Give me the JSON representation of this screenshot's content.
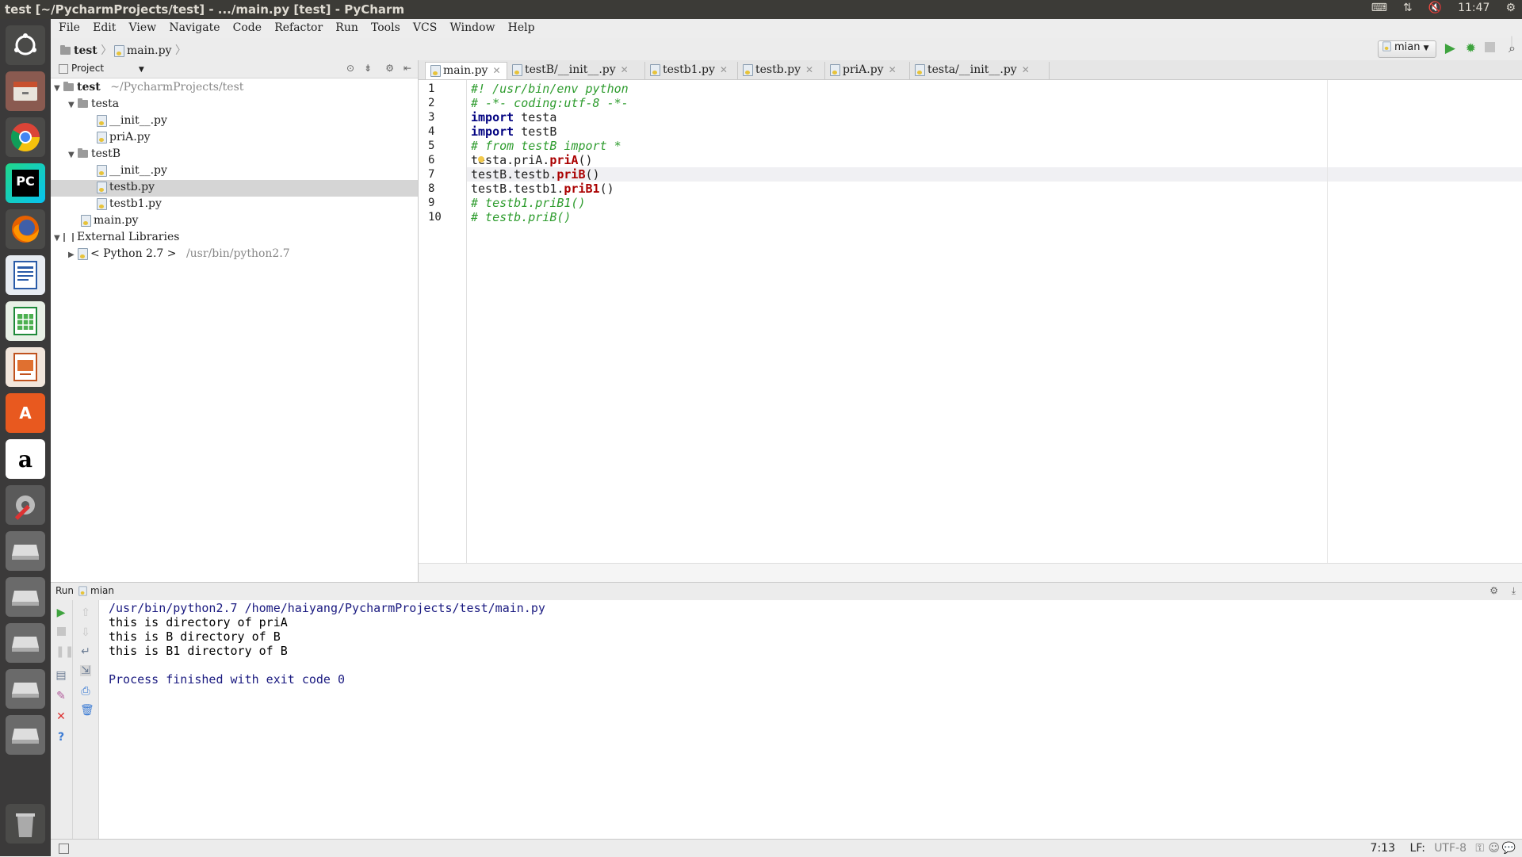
{
  "window": {
    "title": "test [~/PycharmProjects/test] - .../main.py [test] - PyCharm",
    "clock": "11:47"
  },
  "launcher": {
    "items": [
      "ubuntu-dash",
      "files",
      "chrome",
      "pycharm",
      "firefox",
      "writer",
      "calc",
      "impress",
      "software-center",
      "amazon",
      "system-settings",
      "drive-1",
      "drive-2",
      "drive-3",
      "drive-4",
      "drive-5",
      "trash"
    ],
    "pycharm_label": "PC",
    "amazon_label": "a",
    "software_label": "A"
  },
  "menu": [
    "File",
    "Edit",
    "View",
    "Navigate",
    "Code",
    "Refactor",
    "Run",
    "Tools",
    "VCS",
    "Window",
    "Help"
  ],
  "navbar": {
    "crumb_project": "test",
    "crumb_file": "main.py",
    "run_config": "mian"
  },
  "project": {
    "header": "Project",
    "tree": [
      {
        "label": "test",
        "extra": "~/PycharmProjects/test"
      },
      {
        "label": "testa"
      },
      {
        "label": "__init__.py"
      },
      {
        "label": "priA.py"
      },
      {
        "label": "testB"
      },
      {
        "label": "__init__.py"
      },
      {
        "label": "testb.py"
      },
      {
        "label": "testb1.py"
      },
      {
        "label": "main.py"
      },
      {
        "label": "External Libraries"
      },
      {
        "label": "< Python 2.7 >",
        "extra": "/usr/bin/python2.7"
      }
    ]
  },
  "tabs": [
    "main.py",
    "testB/__init__.py",
    "testb1.py",
    "testb.py",
    "priA.py",
    "testa/__init__.py"
  ],
  "editor": {
    "line_numbers": [
      "1",
      "2",
      "3",
      "4",
      "5",
      "6",
      "7",
      "8",
      "9",
      "10"
    ],
    "lines": {
      "l1": "#! /usr/bin/env python",
      "l2": "# -*- coding:utf-8 -*-",
      "l3_kw": "import",
      "l3_rest": " testa",
      "l4_kw": "import",
      "l4_rest": " testB",
      "l5": "# from testB import *",
      "l6_pre": "testa.priA.",
      "l6_fn": "priA",
      "l6_post": "()",
      "l7_pre": "testB.testb.",
      "l7_fn": "priB",
      "l7_post": "()",
      "l8_pre": "testB.testb1.",
      "l8_fn": "priB1",
      "l8_post": "()",
      "l9": "# testb1.priB1()",
      "l10": "# testb.priB()"
    }
  },
  "run": {
    "label": "Run",
    "config": "mian",
    "output": [
      "/usr/bin/python2.7 /home/haiyang/PycharmProjects/test/main.py",
      "this is directory of priA",
      "this is B directory of B",
      "this is B1 directory of B",
      "",
      "Process finished with exit code 0"
    ]
  },
  "status": {
    "position": "7:13",
    "line_sep": "LF:",
    "encoding": "UTF-8"
  }
}
